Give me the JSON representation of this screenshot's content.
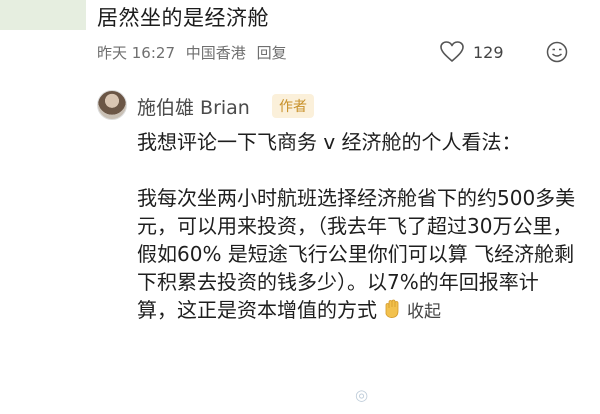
{
  "comment": {
    "text": "居然坐的是经济舱",
    "time": "昨天 16:27",
    "location": "中国香港",
    "reply_label": "回复",
    "like_count": "129"
  },
  "reply": {
    "author": "施伯雄 Brian",
    "badge": "作者",
    "paragraph1": "我想评论一下飞商务 v 经济舱的个人看法：",
    "paragraph2": "我每次坐两小时航班选择经济舱省下的约500多美元，可以用来投资，（我去年飞了超过30万公里，假如60% 是短途飞行公里你们可以算 飞经济舱剩下积累去投资的钱多少）。以7%的年回报率计算，这正是资本增值的方式",
    "collapse_label": "收起"
  },
  "icons": {
    "like": "heart-icon",
    "emoji": "emoji-face-icon",
    "hand": "hand-emoji-icon"
  },
  "colors": {
    "badge_text": "#c8912a",
    "badge_bg": "#fbf0da",
    "meta_text": "#6f6f6f"
  }
}
